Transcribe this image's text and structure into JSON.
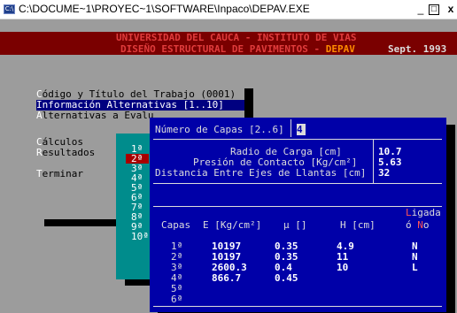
{
  "window": {
    "title": "C:\\DOCUME~1\\PROYEC~1\\SOFTWARE\\Inpaco\\DEPAV.EXE",
    "icon_text": "C:\\",
    "buttons": {
      "minimize": "_",
      "maximize": "□",
      "close": "x"
    }
  },
  "header": {
    "line1": "UNIVERSIDAD DEL CAUCA - INSTITUTO DE VIAS",
    "line2_prefix": "DISEÑO ESTRUCTURAL DE PAVIMENTOS - ",
    "line2_brand": "DEPAV",
    "date": "Sept. 1993"
  },
  "menu": {
    "items": [
      {
        "hot": "C",
        "rest": "ódigo y Título del Trabajo (0001)"
      },
      {
        "hot": "I",
        "rest": "nformación Alternativas [1..10]"
      },
      {
        "hot": "A",
        "rest": "lternativas a Evalu"
      },
      {
        "hot": "C",
        "rest": "álculos"
      },
      {
        "hot": "R",
        "rest": "esultados"
      },
      {
        "hot": "T",
        "rest": "erminar"
      }
    ]
  },
  "year_list": [
    "1ª",
    "2ª",
    "3ª",
    "4ª",
    "5ª",
    "6ª",
    "7ª",
    "8ª",
    "9ª",
    "10ª"
  ],
  "dialog": {
    "capas_label": "Número de Capas [2..6]",
    "capas_value": "4",
    "radio_label": "Radio de Carga [cm]",
    "radio_value": "10.7",
    "presion_label": "Presión de Contacto [Kg/cm²]",
    "presion_value": "5.63",
    "distancia_label": "Distancia Entre Ejes de Llantas [cm]",
    "distancia_value": "32",
    "table_headers": {
      "capas": "Capas",
      "e": "E [Kg/cm²]",
      "mu": "µ []",
      "h": "H [cm]",
      "ligada_hot_l": "L",
      "ligada_rest": "igada",
      "o_prefix": "ó ",
      "o_hot_n": "N",
      "o_rest": "o"
    },
    "rows": [
      {
        "capa": "1ª",
        "e": "10197",
        "mu": "0.35",
        "h": "4.9",
        "ligada": "N"
      },
      {
        "capa": "2ª",
        "e": "10197",
        "mu": "0.35",
        "h": "11",
        "ligada": "N"
      },
      {
        "capa": "3ª",
        "e": "2600.3",
        "mu": "0.4",
        "h": "10",
        "ligada": "L"
      },
      {
        "capa": "4ª",
        "e": "866.7",
        "mu": "0.45",
        "h": "",
        "ligada": ""
      },
      {
        "capa": "5ª",
        "e": "",
        "mu": "",
        "h": "",
        "ligada": ""
      },
      {
        "capa": "6ª",
        "e": "",
        "mu": "",
        "h": "",
        "ligada": ""
      }
    ]
  },
  "colors": {
    "console_bg": "#9c9c9c",
    "header_bg": "#7a0000",
    "header_text": "#e03c3c",
    "dialog_bg": "#0000a8",
    "dialog_text": "#dcdcdc",
    "list_bg": "#008c8c",
    "selection_bg": "#000080",
    "accent_red": "#ff5555",
    "brand_orange": "#ff8c00"
  }
}
